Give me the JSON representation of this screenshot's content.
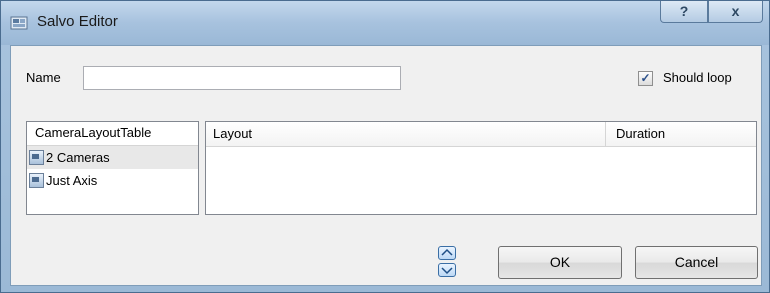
{
  "window": {
    "title": "Salvo Editor",
    "help_label": "?",
    "close_label": "x"
  },
  "form": {
    "name_label": "Name",
    "name_value": "",
    "should_loop_label": "Should loop",
    "should_loop_checked": true
  },
  "camera_list": {
    "header": "CameraLayoutTable",
    "items": [
      {
        "label": "2 Cameras",
        "icon": "camera-layout-icon",
        "selected": true
      },
      {
        "label": "Just Axis",
        "icon": "camera-layout-icon",
        "selected": false
      }
    ]
  },
  "layout_table": {
    "columns": [
      "Layout",
      "Duration"
    ],
    "rows": []
  },
  "buttons": {
    "ok": "OK",
    "cancel": "Cancel"
  },
  "colors": {
    "title_bar": "#a7c2de",
    "client_bg": "#f0f0f0",
    "accent": "#3a6ea5"
  }
}
